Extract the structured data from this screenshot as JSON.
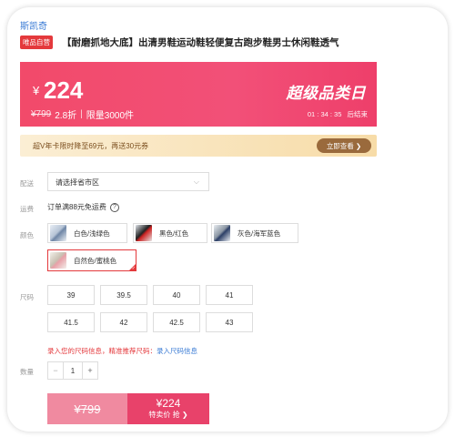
{
  "brand": "斯凯奇",
  "product": {
    "badge": "唯品自营",
    "title": "【耐磨抓地大底】出清男鞋运动鞋轻便复古跑步鞋男士休闲鞋透气"
  },
  "price_banner": {
    "currency": "¥",
    "price": "224",
    "original_price": "¥799",
    "discount": "2.8折",
    "separator": "|",
    "limit": "限量3000件",
    "promo_title": "超级品类日",
    "countdown": "01 : 34 : 35",
    "countdown_suffix": "后结束",
    "colors": {
      "banner": "#f24a6a",
      "accent": "#e4393c"
    }
  },
  "coupon": {
    "text": "超V年卡限时降至69元，再送30元券",
    "button": "立即查看 ❯"
  },
  "delivery": {
    "label": "配送",
    "placeholder": "请选择省市区",
    "chevron_icon": "chevron-down-icon"
  },
  "shipping": {
    "label": "运费",
    "text": "订单满88元免运费",
    "help_icon": "?"
  },
  "colors_section": {
    "label": "颜色",
    "options": [
      {
        "label": "白色/浅绿色",
        "selected": false
      },
      {
        "label": "黑色/红色",
        "selected": false
      },
      {
        "label": "灰色/海军蓝色",
        "selected": false
      },
      {
        "label": "自然色/蜜桃色",
        "selected": true
      }
    ]
  },
  "sizes": {
    "label": "尺码",
    "options": [
      "39",
      "39.5",
      "40",
      "41",
      "41.5",
      "42",
      "42.5",
      "43"
    ]
  },
  "size_hint": {
    "text": "录入您的尺码信息，精准推荐尺码：",
    "link": "录入尺码信息"
  },
  "quantity": {
    "label": "数量",
    "minus": "−",
    "value": "1",
    "plus": "+"
  },
  "buy": {
    "original_price": "¥799",
    "price": "¥224",
    "action": "特卖价 抢 ❯"
  }
}
